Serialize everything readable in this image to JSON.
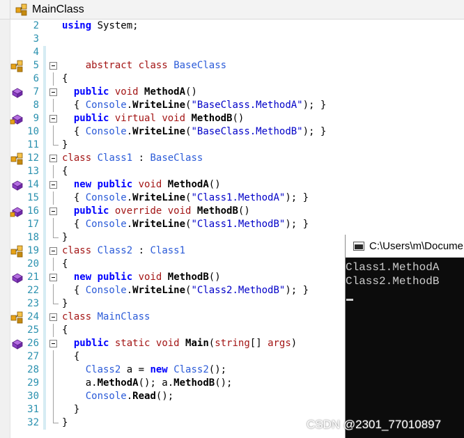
{
  "window": {
    "title": "MainClass",
    "icon": "class-icon"
  },
  "editor": {
    "lines": [
      {
        "num": "2",
        "glyph": "",
        "fold": "",
        "code": [
          [
            "kw",
            "using"
          ],
          [
            "plain",
            " System;"
          ]
        ]
      },
      {
        "num": "3",
        "glyph": "",
        "fold": "",
        "code": []
      },
      {
        "num": "4",
        "glyph": "",
        "fold": "",
        "code": []
      },
      {
        "num": "5",
        "glyph": "class-icon",
        "fold": "box",
        "code": [
          [
            "plain",
            "    "
          ],
          [
            "kw2",
            "abstract"
          ],
          [
            "plain",
            " "
          ],
          [
            "kw2",
            "class"
          ],
          [
            "plain",
            " "
          ],
          [
            "type",
            "BaseClass"
          ]
        ]
      },
      {
        "num": "6",
        "glyph": "",
        "fold": "line",
        "code": [
          [
            "plain",
            "{"
          ]
        ]
      },
      {
        "num": "7",
        "glyph": "method-icon",
        "fold": "box",
        "code": [
          [
            "plain",
            "  "
          ],
          [
            "kw",
            "public"
          ],
          [
            "plain",
            " "
          ],
          [
            "kw2",
            "void"
          ],
          [
            "plain",
            " "
          ],
          [
            "meth",
            "MethodA"
          ],
          [
            "plain",
            "()"
          ]
        ]
      },
      {
        "num": "8",
        "glyph": "",
        "fold": "line",
        "code": [
          [
            "plain",
            "  { "
          ],
          [
            "type",
            "Console"
          ],
          [
            "plain",
            "."
          ],
          [
            "meth",
            "WriteLine"
          ],
          [
            "plain",
            "("
          ],
          [
            "str",
            "\"BaseClass.MethodA\""
          ],
          [
            "plain",
            "); }"
          ]
        ]
      },
      {
        "num": "9",
        "glyph": "virtual-method-icon",
        "fold": "box",
        "code": [
          [
            "plain",
            "  "
          ],
          [
            "kw",
            "public"
          ],
          [
            "plain",
            " "
          ],
          [
            "kw2",
            "virtual"
          ],
          [
            "plain",
            " "
          ],
          [
            "kw2",
            "void"
          ],
          [
            "plain",
            " "
          ],
          [
            "meth",
            "MethodB"
          ],
          [
            "plain",
            "()"
          ]
        ]
      },
      {
        "num": "10",
        "glyph": "",
        "fold": "line",
        "code": [
          [
            "plain",
            "  { "
          ],
          [
            "type",
            "Console"
          ],
          [
            "plain",
            "."
          ],
          [
            "meth",
            "WriteLine"
          ],
          [
            "plain",
            "("
          ],
          [
            "str",
            "\"BaseClass.MethodB\""
          ],
          [
            "plain",
            "); }"
          ]
        ]
      },
      {
        "num": "11",
        "glyph": "",
        "fold": "end",
        "code": [
          [
            "plain",
            "}"
          ]
        ]
      },
      {
        "num": "12",
        "glyph": "class-icon",
        "fold": "box",
        "code": [
          [
            "kw2",
            "class"
          ],
          [
            "plain",
            " "
          ],
          [
            "type",
            "Class1"
          ],
          [
            "plain",
            " : "
          ],
          [
            "type",
            "BaseClass"
          ]
        ]
      },
      {
        "num": "13",
        "glyph": "",
        "fold": "line",
        "code": [
          [
            "plain",
            "{"
          ]
        ]
      },
      {
        "num": "14",
        "glyph": "method-icon",
        "fold": "box",
        "code": [
          [
            "plain",
            "  "
          ],
          [
            "kw",
            "new"
          ],
          [
            "plain",
            " "
          ],
          [
            "kw",
            "public"
          ],
          [
            "plain",
            " "
          ],
          [
            "kw2",
            "void"
          ],
          [
            "plain",
            " "
          ],
          [
            "meth",
            "MethodA"
          ],
          [
            "plain",
            "()"
          ]
        ]
      },
      {
        "num": "15",
        "glyph": "",
        "fold": "line",
        "code": [
          [
            "plain",
            "  { "
          ],
          [
            "type",
            "Console"
          ],
          [
            "plain",
            "."
          ],
          [
            "meth",
            "WriteLine"
          ],
          [
            "plain",
            "("
          ],
          [
            "str",
            "\"Class1.MethodA\""
          ],
          [
            "plain",
            "); }"
          ]
        ]
      },
      {
        "num": "16",
        "glyph": "virtual-method-icon",
        "fold": "box",
        "code": [
          [
            "plain",
            "  "
          ],
          [
            "kw",
            "public"
          ],
          [
            "plain",
            " "
          ],
          [
            "kw2",
            "override"
          ],
          [
            "plain",
            " "
          ],
          [
            "kw2",
            "void"
          ],
          [
            "plain",
            " "
          ],
          [
            "meth",
            "MethodB"
          ],
          [
            "plain",
            "()"
          ]
        ]
      },
      {
        "num": "17",
        "glyph": "",
        "fold": "line",
        "code": [
          [
            "plain",
            "  { "
          ],
          [
            "type",
            "Console"
          ],
          [
            "plain",
            "."
          ],
          [
            "meth",
            "WriteLine"
          ],
          [
            "plain",
            "("
          ],
          [
            "str",
            "\"Class1.MethodB\""
          ],
          [
            "plain",
            "); }"
          ]
        ]
      },
      {
        "num": "18",
        "glyph": "",
        "fold": "end",
        "code": [
          [
            "plain",
            "}"
          ]
        ]
      },
      {
        "num": "19",
        "glyph": "class-icon",
        "fold": "box",
        "code": [
          [
            "kw2",
            "class"
          ],
          [
            "plain",
            " "
          ],
          [
            "type",
            "Class2"
          ],
          [
            "plain",
            " : "
          ],
          [
            "type",
            "Class1"
          ]
        ]
      },
      {
        "num": "20",
        "glyph": "",
        "fold": "line",
        "code": [
          [
            "plain",
            "{"
          ]
        ]
      },
      {
        "num": "21",
        "glyph": "method-icon",
        "fold": "box",
        "code": [
          [
            "plain",
            "  "
          ],
          [
            "kw",
            "new"
          ],
          [
            "plain",
            " "
          ],
          [
            "kw",
            "public"
          ],
          [
            "plain",
            " "
          ],
          [
            "kw2",
            "void"
          ],
          [
            "plain",
            " "
          ],
          [
            "meth",
            "MethodB"
          ],
          [
            "plain",
            "()"
          ]
        ]
      },
      {
        "num": "22",
        "glyph": "",
        "fold": "line",
        "code": [
          [
            "plain",
            "  { "
          ],
          [
            "type",
            "Console"
          ],
          [
            "plain",
            "."
          ],
          [
            "meth",
            "WriteLine"
          ],
          [
            "plain",
            "("
          ],
          [
            "str",
            "\"Class2.MethodB\""
          ],
          [
            "plain",
            "); }"
          ]
        ]
      },
      {
        "num": "23",
        "glyph": "",
        "fold": "end",
        "code": [
          [
            "plain",
            "}"
          ]
        ]
      },
      {
        "num": "24",
        "glyph": "class-icon",
        "fold": "box",
        "code": [
          [
            "kw2",
            "class"
          ],
          [
            "plain",
            " "
          ],
          [
            "type",
            "MainClass"
          ]
        ]
      },
      {
        "num": "25",
        "glyph": "",
        "fold": "line",
        "code": [
          [
            "plain",
            "{"
          ]
        ]
      },
      {
        "num": "26",
        "glyph": "method-icon",
        "fold": "box",
        "code": [
          [
            "plain",
            "  "
          ],
          [
            "kw",
            "public"
          ],
          [
            "plain",
            " "
          ],
          [
            "kw2",
            "static"
          ],
          [
            "plain",
            " "
          ],
          [
            "kw2",
            "void"
          ],
          [
            "plain",
            " "
          ],
          [
            "meth",
            "Main"
          ],
          [
            "plain",
            "("
          ],
          [
            "kw2",
            "string"
          ],
          [
            "plain",
            "[] "
          ],
          [
            "kw2",
            "args"
          ],
          [
            "plain",
            ")"
          ]
        ]
      },
      {
        "num": "27",
        "glyph": "",
        "fold": "line",
        "code": [
          [
            "plain",
            "  {"
          ]
        ]
      },
      {
        "num": "28",
        "glyph": "",
        "fold": "line",
        "code": [
          [
            "plain",
            "    "
          ],
          [
            "type",
            "Class2"
          ],
          [
            "plain",
            " a = "
          ],
          [
            "kw",
            "new"
          ],
          [
            "plain",
            " "
          ],
          [
            "type",
            "Class2"
          ],
          [
            "plain",
            "();"
          ]
        ]
      },
      {
        "num": "29",
        "glyph": "",
        "fold": "line",
        "code": [
          [
            "plain",
            "    a."
          ],
          [
            "meth",
            "MethodA"
          ],
          [
            "plain",
            "(); a."
          ],
          [
            "meth",
            "MethodB"
          ],
          [
            "plain",
            "();"
          ]
        ]
      },
      {
        "num": "30",
        "glyph": "",
        "fold": "line",
        "code": [
          [
            "plain",
            "    "
          ],
          [
            "type",
            "Console"
          ],
          [
            "plain",
            "."
          ],
          [
            "meth",
            "Read"
          ],
          [
            "plain",
            "();"
          ]
        ]
      },
      {
        "num": "31",
        "glyph": "",
        "fold": "line",
        "code": [
          [
            "plain",
            "  }"
          ]
        ]
      },
      {
        "num": "32",
        "glyph": "",
        "fold": "end",
        "code": [
          [
            "plain",
            "}"
          ]
        ]
      }
    ]
  },
  "console": {
    "title": "C:\\Users\\m\\Documents\\Visual Studio",
    "output": [
      "Class1.MethodA",
      "Class2.MethodB"
    ]
  },
  "watermark": "CSDN @2301_77010897"
}
